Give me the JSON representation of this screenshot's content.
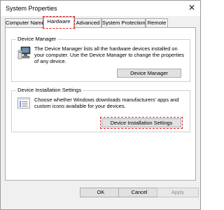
{
  "window": {
    "title": "System Properties",
    "close_glyph": "✕"
  },
  "tabs": [
    {
      "label": "Computer Name"
    },
    {
      "label": "Hardware"
    },
    {
      "label": "Advanced"
    },
    {
      "label": "System Protection"
    },
    {
      "label": "Remote"
    }
  ],
  "device_manager": {
    "group_label": "Device Manager",
    "description": "The Device Manager lists all the hardware devices installed on your computer. Use the Device Manager to change the properties of any device.",
    "button_label": "Device Manager",
    "icon": "computer-icon"
  },
  "device_installation": {
    "group_label": "Device Installation Settings",
    "description": "Choose whether Windows downloads manufacturers' apps and custom icons available for your devices.",
    "button_label": "Device Installation Settings",
    "icon": "settings-list-icon"
  },
  "footer": {
    "ok_label": "OK",
    "cancel_label": "Cancel",
    "apply_label": "Apply"
  },
  "colors": {
    "highlight": "#e02020",
    "dialog_bg": "#f0f0f0",
    "button_bg": "#e1e1e1"
  }
}
